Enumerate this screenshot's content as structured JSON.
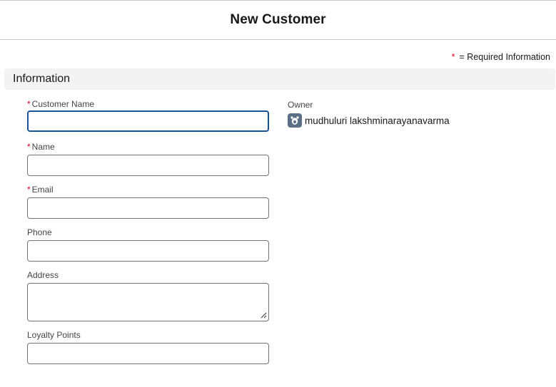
{
  "header": {
    "title": "New Customer"
  },
  "legend": {
    "star": "*",
    "text": "= Required Information"
  },
  "section": {
    "title": "Information"
  },
  "fields": {
    "customer_name": {
      "label": "Customer Name",
      "required": "*",
      "value": ""
    },
    "name": {
      "label": "Name",
      "required": "*",
      "value": ""
    },
    "email": {
      "label": "Email",
      "required": "*",
      "value": ""
    },
    "phone": {
      "label": "Phone",
      "value": ""
    },
    "address": {
      "label": "Address",
      "value": ""
    },
    "loyalty_points": {
      "label": "Loyalty Points",
      "value": ""
    }
  },
  "owner": {
    "label": "Owner",
    "name": "mudhuluri lakshminarayanavarma",
    "icon": "user-avatar-icon"
  },
  "colors": {
    "required": "#ea001e",
    "focus_border": "#1b5297",
    "section_bg": "#f3f3f3",
    "avatar_bg": "#5b6f86"
  }
}
